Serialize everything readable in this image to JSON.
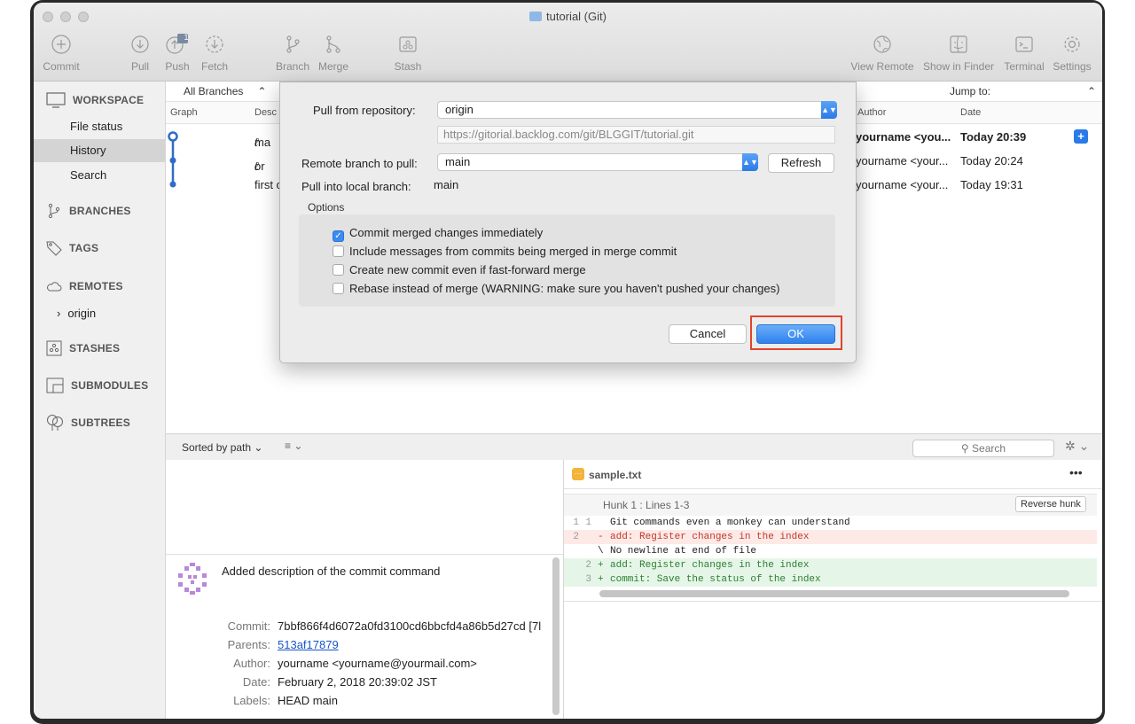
{
  "window": {
    "title": "tutorial (Git)"
  },
  "toolbar": {
    "commit": "Commit",
    "pull": "Pull",
    "push": "Push",
    "push_badge": "1",
    "fetch": "Fetch",
    "branch": "Branch",
    "merge": "Merge",
    "stash": "Stash",
    "view_remote": "View Remote",
    "show_in_finder": "Show in Finder",
    "terminal": "Terminal",
    "settings": "Settings"
  },
  "sidebar": {
    "workspace": "WORKSPACE",
    "items": [
      "File status",
      "History",
      "Search"
    ],
    "selected": "History",
    "branches": "BRANCHES",
    "tags": "TAGS",
    "remotes": "REMOTES",
    "remote_origin": "origin",
    "stashes": "STASHES",
    "submodules": "SUBMODULES",
    "subtrees": "SUBTREES"
  },
  "history": {
    "branch_filter": "All Branches",
    "jump_to": "Jump to:",
    "columns": {
      "graph": "Graph",
      "description": "Desc",
      "author": "Author",
      "date": "Date"
    },
    "rows": [
      {
        "desc": "ma",
        "author": "yourname <you...",
        "date": "Today 20:39"
      },
      {
        "desc": "or",
        "author": "yourname <your...",
        "date": "Today 20:24"
      },
      {
        "desc": "first c",
        "author": "yourname <your...",
        "date": "Today 19:31"
      }
    ]
  },
  "lower": {
    "sorted_by": "Sorted by path ⌄",
    "search_placeholder": "Search",
    "commit_message": "Added description of the commit command",
    "details": {
      "commit_label": "Commit:",
      "commit": "7bbf866f4d6072a0fd3100cd6bbcfd4a86b5d27cd [7l",
      "parents_label": "Parents:",
      "parents": "513af17879",
      "author_label": "Author:",
      "author": "yourname <yourname@yourmail.com>",
      "date_label": "Date:",
      "date": "February 2, 2018 20:39:02 JST",
      "labels_label": "Labels:",
      "labels_head": "HEAD",
      "labels_branch": "main"
    },
    "file": "sample.txt",
    "hunk": "Hunk 1 : Lines 1-3",
    "reverse_hunk": "Reverse hunk",
    "diff": [
      {
        "old": "1",
        "new": "1",
        "sign": " ",
        "text": "Git commands even a monkey can understand",
        "kind": "ctx"
      },
      {
        "old": "2",
        "new": "",
        "sign": "-",
        "text": "add: Register changes in the index",
        "kind": "del"
      },
      {
        "old": "",
        "new": "",
        "sign": "\\",
        "text": "No newline at end of file",
        "kind": "ctx"
      },
      {
        "old": "",
        "new": "2",
        "sign": "+",
        "text": "add: Register changes in the index",
        "kind": "add"
      },
      {
        "old": "",
        "new": "3",
        "sign": "+",
        "text": "commit: Save the status of the index",
        "kind": "add"
      }
    ]
  },
  "dialog": {
    "pull_from_label": "Pull from repository:",
    "pull_from": "origin",
    "url": "https://gitorial.backlog.com/git/BLGGIT/tutorial.git",
    "remote_branch_label": "Remote branch to pull:",
    "remote_branch": "main",
    "refresh": "Refresh",
    "local_branch_label": "Pull into local branch:",
    "local_branch": "main",
    "options_title": "Options",
    "options": [
      {
        "label": "Commit merged changes immediately",
        "checked": true
      },
      {
        "label": "Include messages from commits being merged in merge commit",
        "checked": false
      },
      {
        "label": "Create new commit even if fast-forward merge",
        "checked": false
      },
      {
        "label": "Rebase instead of merge (WARNING: make sure you haven't pushed your changes)",
        "checked": false
      }
    ],
    "cancel": "Cancel",
    "ok": "OK"
  },
  "colors": {
    "accent": "#2a7ae8",
    "highlight_box": "#e0442b",
    "graph": "#2f6cc7",
    "del_bg": "#fde9e6",
    "add_bg": "#e5f6e8"
  }
}
